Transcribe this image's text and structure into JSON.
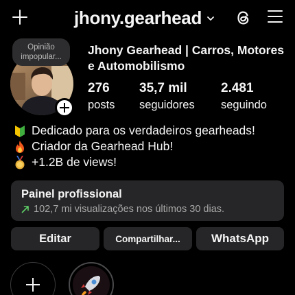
{
  "header": {
    "username": "jhony.gearhead"
  },
  "profile": {
    "note": "Opinião impopular...",
    "full_name": "Jhony Gearhead | Carros, Motores e Automobilismo",
    "stats": [
      {
        "value": "276",
        "label": "posts"
      },
      {
        "value": "35,7 mil",
        "label": "seguidores"
      },
      {
        "value": "2.481",
        "label": "seguindo"
      }
    ],
    "bio": [
      {
        "icon": "beginner-badge-icon",
        "text": "Dedicado para os verdadeiros gearheads!"
      },
      {
        "icon": "fire-icon",
        "text": "Criador da Gearhead Hub!"
      },
      {
        "icon": "medal-icon",
        "text": "+1.2B de views!"
      }
    ]
  },
  "dashboard": {
    "title": "Painel profissional",
    "subtitle": "102,7 mi visualizações nos últimos 30 dias."
  },
  "buttons": {
    "edit": "Editar",
    "share": "Compartilhar...",
    "whatsapp": "WhatsApp"
  },
  "highlights": [
    {
      "icon": "plus-icon"
    },
    {
      "icon": "rocket-icon"
    }
  ],
  "colors": {
    "background": "#000000",
    "text": "#f5f5f5",
    "card": "#262628",
    "muted": "#a8a8a8",
    "trend": "#5fd067"
  }
}
